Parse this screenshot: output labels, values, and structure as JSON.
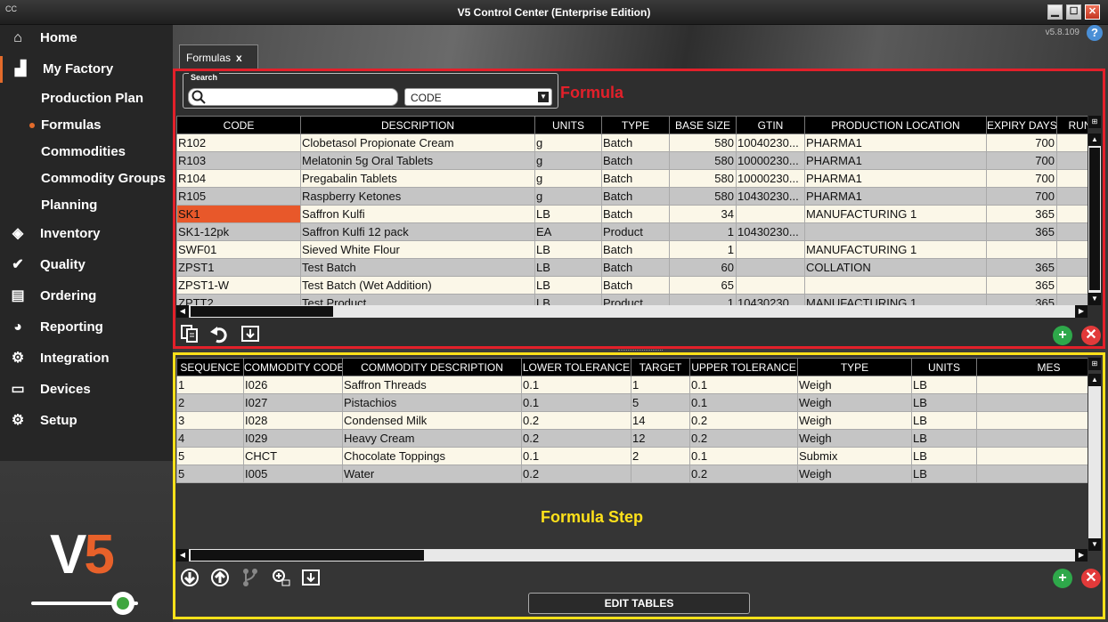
{
  "window": {
    "app_icon": "CC",
    "title": "V5 Control Center (Enterprise Edition)",
    "minimize": "▁",
    "maximize": "☐",
    "close": "✕"
  },
  "header": {
    "version": "v5.8.109",
    "help": "?"
  },
  "sidebar": {
    "items": [
      {
        "label": "Home",
        "icon": "⌂"
      },
      {
        "label": "My Factory",
        "icon": "▟"
      },
      {
        "label": "Inventory",
        "icon": "◈"
      },
      {
        "label": "Quality",
        "icon": "✔"
      },
      {
        "label": "Ordering",
        "icon": "▤"
      },
      {
        "label": "Reporting",
        "icon": "◕"
      },
      {
        "label": "Integration",
        "icon": "⚙"
      },
      {
        "label": "Devices",
        "icon": "▭"
      },
      {
        "label": "Setup",
        "icon": "⚙"
      }
    ],
    "sub_items": [
      "Production Plan",
      "Formulas",
      "Commodities",
      "Commodity Groups",
      "Planning"
    ],
    "logo_v": "V",
    "logo_5": "5"
  },
  "tab": {
    "label": "Formulas",
    "close": "x"
  },
  "formula_panel": {
    "title": "Formula",
    "search_label": "Search",
    "search_value": "",
    "search_field": "CODE",
    "columns": [
      "CODE",
      "DESCRIPTION",
      "UNITS",
      "TYPE",
      "BASE SIZE",
      "GTIN",
      "PRODUCTION LOCATION",
      "EXPIRY DAYS",
      "RUN"
    ],
    "rows": [
      [
        "R102",
        "Clobetasol Propionate Cream",
        "g",
        "Batch",
        "580",
        "10040230...",
        "PHARMA1",
        "700",
        ""
      ],
      [
        "R103",
        "Melatonin 5g Oral Tablets",
        "g",
        "Batch",
        "580",
        "10000230...",
        "PHARMA1",
        "700",
        ""
      ],
      [
        "R104",
        "Pregabalin Tablets",
        "g",
        "Batch",
        "580",
        "10000230...",
        "PHARMA1",
        "700",
        ""
      ],
      [
        "R105",
        "Raspberry Ketones",
        "g",
        "Batch",
        "580",
        "10430230...",
        "PHARMA1",
        "700",
        ""
      ],
      [
        "SK1",
        "Saffron Kulfi",
        "LB",
        "Batch",
        "34",
        "",
        "MANUFACTURING 1",
        "365",
        ""
      ],
      [
        "SK1-12pk",
        "Saffron Kulfi 12 pack",
        "EA",
        "Product",
        "1",
        "10430230...",
        "",
        "365",
        ""
      ],
      [
        "SWF01",
        "Sieved White Flour",
        "LB",
        "Batch",
        "1",
        "",
        "MANUFACTURING 1",
        "",
        ""
      ],
      [
        "ZPST1",
        "Test Batch",
        "LB",
        "Batch",
        "60",
        "",
        "COLLATION",
        "365",
        ""
      ],
      [
        "ZPST1-W",
        "Test Batch (Wet Addition)",
        "LB",
        "Batch",
        "65",
        "",
        "",
        "365",
        ""
      ],
      [
        "ZPTT2",
        "Test Product",
        "LB",
        "Product",
        "1",
        "10430230...",
        "MANUFACTURING 1",
        "365",
        ""
      ]
    ]
  },
  "step_panel": {
    "title": "Formula Step",
    "columns": [
      "SEQUENCE",
      "COMMODITY CODE",
      "COMMODITY DESCRIPTION",
      "LOWER TOLERANCE",
      "TARGET",
      "UPPER TOLERANCE",
      "TYPE",
      "UNITS",
      "MES"
    ],
    "rows": [
      [
        "1",
        "I026",
        "Saffron Threads",
        "0.1",
        "1",
        "0.1",
        "Weigh",
        "LB",
        ""
      ],
      [
        "2",
        "I027",
        "Pistachios",
        "0.1",
        "5",
        "0.1",
        "Weigh",
        "LB",
        ""
      ],
      [
        "3",
        "I028",
        "Condensed Milk",
        "0.2",
        "14",
        "0.2",
        "Weigh",
        "LB",
        ""
      ],
      [
        "4",
        "I029",
        "Heavy Cream",
        "0.2",
        "12",
        "0.2",
        "Weigh",
        "LB",
        ""
      ],
      [
        "5",
        "CHCT",
        "Chocolate Toppings",
        "0.1",
        "2",
        "0.1",
        "Submix",
        "LB",
        ""
      ],
      [
        "5",
        "I005",
        "Water",
        "0.2",
        "",
        "0.2",
        "Weigh",
        "LB",
        ""
      ]
    ],
    "edit_tables": "EDIT TABLES"
  },
  "buttons": {
    "add": "+",
    "delete": "✕"
  }
}
